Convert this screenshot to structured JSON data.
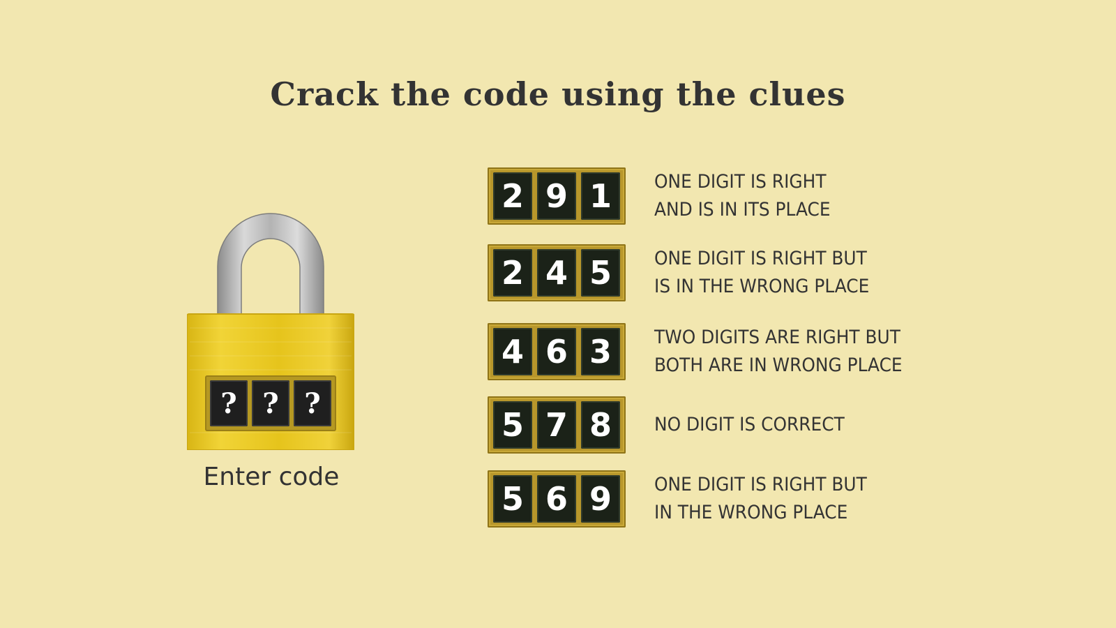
{
  "title": "Crack the code using the clues",
  "lock": {
    "digits": [
      "?",
      "?",
      "?"
    ],
    "label": "Enter code"
  },
  "clues": [
    {
      "digits": [
        "2",
        "9",
        "1"
      ],
      "lines": [
        "ONE DIGIT IS RIGHT",
        "AND IS IN ITS PLACE"
      ]
    },
    {
      "digits": [
        "2",
        "4",
        "5"
      ],
      "lines": [
        "ONE DIGIT IS RIGHT BUT",
        "IS IN THE WRONG PLACE"
      ]
    },
    {
      "digits": [
        "4",
        "6",
        "3"
      ],
      "lines": [
        "TWO DIGITS ARE RIGHT BUT",
        "BOTH ARE IN WRONG PLACE"
      ]
    },
    {
      "digits": [
        "5",
        "7",
        "8"
      ],
      "lines": [
        "NO DIGIT IS CORRECT"
      ]
    },
    {
      "digits": [
        "5",
        "6",
        "9"
      ],
      "lines": [
        "ONE DIGIT IS RIGHT BUT",
        "IN THE WRONG PLACE"
      ]
    }
  ],
  "colors": {
    "background": "#f2e7b0",
    "lock_body": "#e9c81f",
    "shackle": "#a9a9a9",
    "digit_tile": "#1b2218",
    "frame": "#b8972b"
  }
}
